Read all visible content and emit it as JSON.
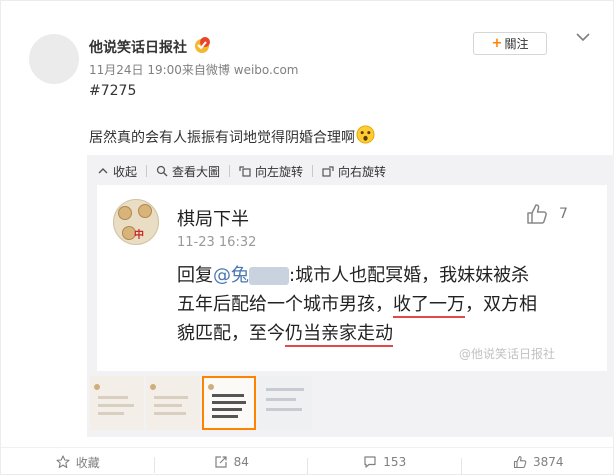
{
  "post": {
    "author": "他说笑话日报社",
    "meta": "11月24日 19:00来自微博 weibo.com",
    "tag": "#7275",
    "text": "居然真的会有人振振有词地觉得阴婚合理啊",
    "follow_label": "關注"
  },
  "toolbar": {
    "collapse_label": "收起",
    "view_large_label": "查看大圖",
    "rotate_left_label": "向左旋转",
    "rotate_right_label": "向右旋转"
  },
  "image": {
    "name": "棋局下半",
    "time": "11-23 16:32",
    "likes": "7",
    "reply_prefix": "回复",
    "mention": "@兔",
    "line1_rest": ":城市人也配冥婚，我妹妹被杀",
    "line2_a": "五年后配给一个城市男孩，",
    "line2_ul": "收了一万",
    "line2_b": "，双方相",
    "line3_a": "貌匹配，至今",
    "line3_ul": "仍当亲家走动",
    "watermark": "@他说笑话日报社"
  },
  "footer": {
    "favorite_label": "收藏",
    "repost_count": "84",
    "comment_count": "153",
    "like_count": "3874"
  },
  "colors": {
    "accent": "#ff8200",
    "mention": "#4a77b0",
    "underline": "#e04a4a"
  }
}
